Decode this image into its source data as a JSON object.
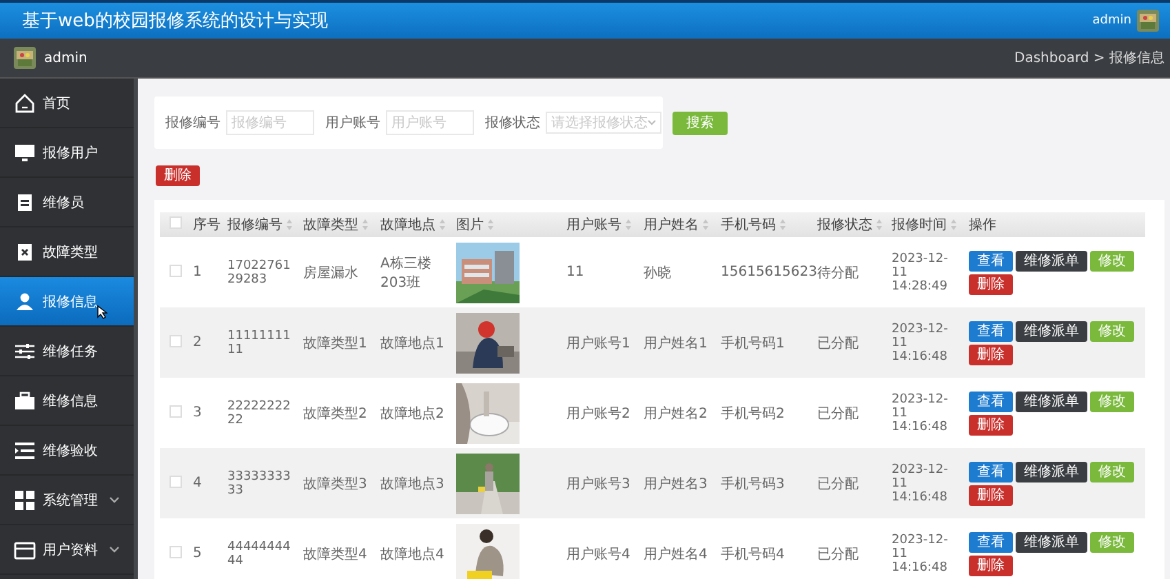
{
  "header": {
    "title": "基于web的校园报修系统的设计与实现",
    "user": "admin"
  },
  "subheader": {
    "user": "admin",
    "breadcrumb": "Dashboard > 报修信息"
  },
  "sidebar": {
    "items": [
      {
        "label": "首页",
        "selected": false
      },
      {
        "label": "报修用户",
        "selected": false
      },
      {
        "label": "维修员",
        "selected": false
      },
      {
        "label": "故障类型",
        "selected": false
      },
      {
        "label": "报修信息",
        "selected": true
      },
      {
        "label": "维修任务",
        "selected": false
      },
      {
        "label": "维修信息",
        "selected": false
      },
      {
        "label": "维修验收",
        "selected": false
      },
      {
        "label": "系统管理",
        "selected": false,
        "expandable": true
      },
      {
        "label": "用户资料",
        "selected": false,
        "expandable": true
      }
    ]
  },
  "search": {
    "fields": [
      {
        "kind": "input",
        "label": "报修编号",
        "placeholder": "报修编号"
      },
      {
        "kind": "input",
        "label": "用户账号",
        "placeholder": "用户账号"
      },
      {
        "kind": "select",
        "label": "报修状态",
        "placeholder": "请选择报修状态"
      }
    ],
    "button": "搜索"
  },
  "delete_button": "删除",
  "table": {
    "all_checked": false,
    "columns": [
      {
        "label": "序号",
        "sortable": false
      },
      {
        "label": "报修编号",
        "sortable": true
      },
      {
        "label": "故障类型",
        "sortable": true
      },
      {
        "label": "故障地点",
        "sortable": true
      },
      {
        "label": "图片",
        "sortable": true
      },
      {
        "label": "用户账号",
        "sortable": true
      },
      {
        "label": "用户姓名",
        "sortable": true
      },
      {
        "label": "手机号码",
        "sortable": true
      },
      {
        "label": "报修状态",
        "sortable": true
      },
      {
        "label": "报修时间",
        "sortable": true
      },
      {
        "label": "操作",
        "sortable": false
      }
    ],
    "rows": [
      {
        "checked": false,
        "index": "1",
        "code": "1702276129283",
        "type": "房屋漏水",
        "place": "A栋三楼203班",
        "picture": {
          "kind": "picture"
        },
        "account": "11",
        "name": "孙晓",
        "phone": "15615615623",
        "status": "待分配",
        "time": "2023-12-11 14:28:49",
        "actions": [
          {
            "kind": "view",
            "label": "查看"
          },
          {
            "kind": "dispatch",
            "label": "维修派单"
          },
          {
            "kind": "edit",
            "label": "修改"
          },
          {
            "kind": "delete",
            "label": "删除"
          }
        ]
      },
      {
        "checked": false,
        "index": "2",
        "code": "1111111111",
        "type": "故障类型1",
        "place": "故障地点1",
        "picture": {
          "kind": "picture"
        },
        "account": "用户账号1",
        "name": "用户姓名1",
        "phone": "手机号码1",
        "status": "已分配",
        "time": "2023-12-11 14:16:48",
        "actions": [
          {
            "kind": "view",
            "label": "查看"
          },
          {
            "kind": "dispatch",
            "label": "维修派单"
          },
          {
            "kind": "edit",
            "label": "修改"
          },
          {
            "kind": "delete",
            "label": "删除"
          }
        ]
      },
      {
        "checked": false,
        "index": "3",
        "code": "2222222222",
        "type": "故障类型2",
        "place": "故障地点2",
        "picture": {
          "kind": "picture"
        },
        "account": "用户账号2",
        "name": "用户姓名2",
        "phone": "手机号码2",
        "status": "已分配",
        "time": "2023-12-11 14:16:48",
        "actions": [
          {
            "kind": "view",
            "label": "查看"
          },
          {
            "kind": "dispatch",
            "label": "维修派单"
          },
          {
            "kind": "edit",
            "label": "修改"
          },
          {
            "kind": "delete",
            "label": "删除"
          }
        ]
      },
      {
        "checked": false,
        "index": "4",
        "code": "3333333333",
        "type": "故障类型3",
        "place": "故障地点3",
        "picture": {
          "kind": "picture"
        },
        "account": "用户账号3",
        "name": "用户姓名3",
        "phone": "手机号码3",
        "status": "已分配",
        "time": "2023-12-11 14:16:48",
        "actions": [
          {
            "kind": "view",
            "label": "查看"
          },
          {
            "kind": "dispatch",
            "label": "维修派单"
          },
          {
            "kind": "edit",
            "label": "修改"
          },
          {
            "kind": "delete",
            "label": "删除"
          }
        ]
      },
      {
        "checked": false,
        "index": "5",
        "code": "4444444444",
        "type": "故障类型4",
        "place": "故障地点4",
        "picture": {
          "kind": "picture"
        },
        "account": "用户账号4",
        "name": "用户姓名4",
        "phone": "手机号码4",
        "status": "已分配",
        "time": "2023-12-11 14:16:48",
        "actions": [
          {
            "kind": "view",
            "label": "查看"
          },
          {
            "kind": "dispatch",
            "label": "维修派单"
          },
          {
            "kind": "edit",
            "label": "修改"
          },
          {
            "kind": "delete",
            "label": "删除"
          }
        ]
      }
    ]
  }
}
